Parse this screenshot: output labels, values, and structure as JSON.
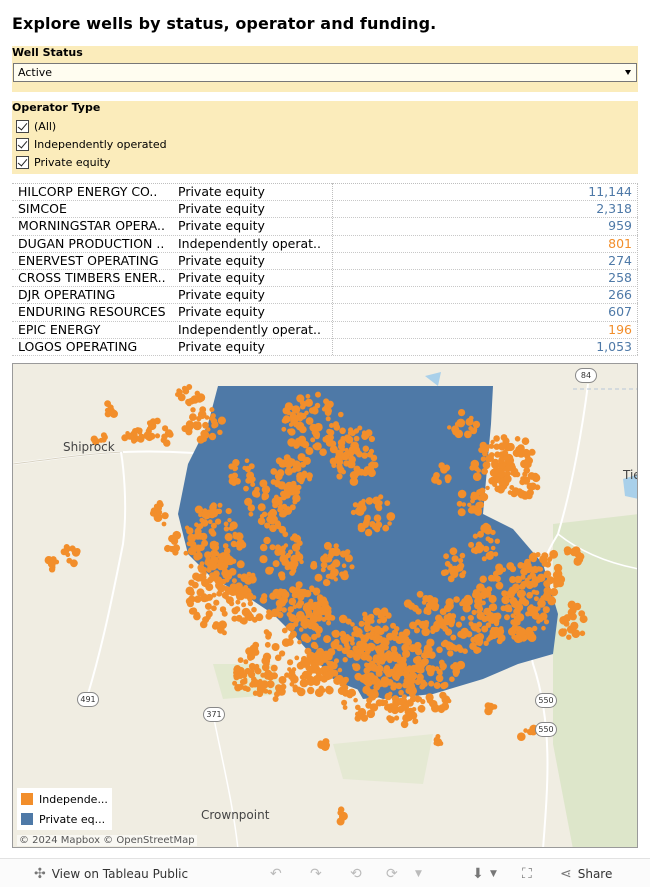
{
  "title": "Explore wells by status, operator and funding.",
  "well_status": {
    "label": "Well Status",
    "selected": "Active"
  },
  "operator_type": {
    "label": "Operator Type",
    "options": [
      {
        "label": "(All)",
        "checked": true
      },
      {
        "label": "Independently operated",
        "checked": true
      },
      {
        "label": "Private equity",
        "checked": true
      }
    ]
  },
  "colors": {
    "independent": "#f28e2b",
    "private_equity": "#4e79a7",
    "panel": "#fbecbb"
  },
  "table": {
    "rows": [
      {
        "operator": "HILCORP ENERGY CO..",
        "type": "Private equity",
        "wells": "11,144"
      },
      {
        "operator": "SIMCOE",
        "type": "Private equity",
        "wells": "2,318"
      },
      {
        "operator": "MORNINGSTAR OPERA..",
        "type": "Private equity",
        "wells": "959"
      },
      {
        "operator": "DUGAN PRODUCTION ..",
        "type": "Independently operat..",
        "wells": "801"
      },
      {
        "operator": "ENERVEST OPERATING",
        "type": "Private equity",
        "wells": "274"
      },
      {
        "operator": "CROSS TIMBERS ENER..",
        "type": "Private equity",
        "wells": "258"
      },
      {
        "operator": "DJR OPERATING",
        "type": "Private equity",
        "wells": "266"
      },
      {
        "operator": "ENDURING RESOURCES",
        "type": "Private equity",
        "wells": "607"
      },
      {
        "operator": "EPIC ENERGY",
        "type": "Independently operat..",
        "wells": "196"
      },
      {
        "operator": "LOGOS OPERATING",
        "type": "Private equity",
        "wells": "1,053"
      }
    ]
  },
  "map": {
    "places": {
      "shiprock": "Shiprock",
      "crownpoint": "Crownpoint",
      "tie": "Tie"
    },
    "shields": {
      "us84": "84",
      "us491": "491",
      "r371": "371",
      "us550a": "550",
      "us550b": "550"
    },
    "legend": {
      "independent": "Independe...",
      "private": "Private eq..."
    },
    "attribution": "© 2024 Mapbox  © OpenStreetMap"
  },
  "toolbar": {
    "view_label": "View on Tableau Public",
    "share_label": "Share"
  }
}
